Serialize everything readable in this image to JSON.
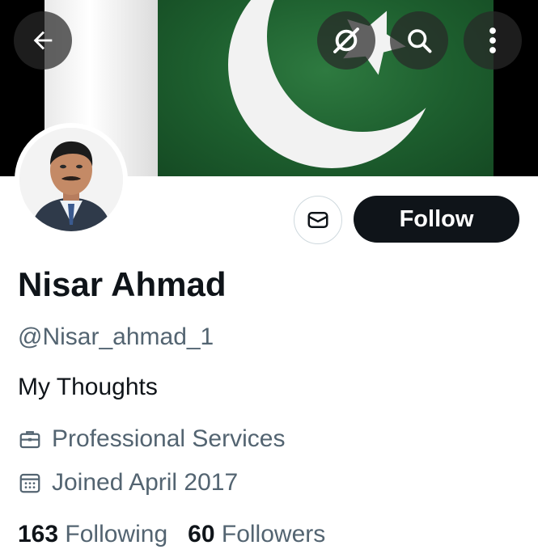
{
  "profile": {
    "name": "Nisar Ahmad",
    "handle": "@Nisar_ahmad_1",
    "bio": "My Thoughts",
    "category": "Professional Services",
    "joined": "Joined April 2017",
    "following_count": "163",
    "following_label": "Following",
    "followers_count": "60",
    "followers_label": "Followers"
  },
  "actions": {
    "follow_label": "Follow"
  },
  "icons": {
    "back": "arrow-left-icon",
    "grok": "grok-icon",
    "search": "search-icon",
    "more": "more-vertical-icon",
    "message": "envelope-icon",
    "category": "briefcase-icon",
    "joined": "calendar-icon"
  },
  "colors": {
    "text_primary": "#0f1419",
    "text_secondary": "#536471",
    "follow_button_bg": "#0f1419",
    "banner_green": "#1d5e2e"
  }
}
